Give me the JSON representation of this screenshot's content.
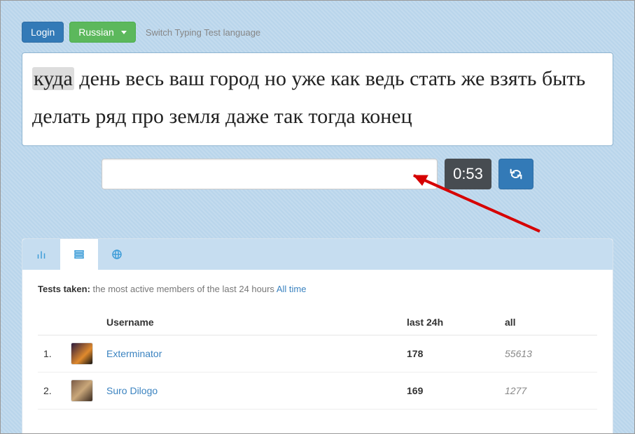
{
  "header": {
    "login_label": "Login",
    "language_label": "Russian",
    "switch_note": "Switch Typing Test language"
  },
  "words": [
    "куда",
    "день",
    "весь",
    "ваш",
    "город",
    "но",
    "уже",
    "как",
    "ведь",
    "стать",
    "же",
    "взять",
    "быть",
    "делать",
    "ряд",
    "про",
    "земля",
    "даже",
    "так",
    "тогда",
    "конец"
  ],
  "current_word_index": 0,
  "typing": {
    "input_value": "",
    "timer": "0:53"
  },
  "stats": {
    "tests_taken_label": "Tests taken:",
    "tests_taken_desc": "the most active members of the last 24 hours",
    "all_time_link": "All time",
    "columns": {
      "rank": "",
      "avatar": "",
      "username": "Username",
      "last24": "last 24h",
      "all": "all"
    },
    "rows": [
      {
        "rank": "1.",
        "username": "Exterminator",
        "last24": "178",
        "all": "55613",
        "avatar_bg": "linear-gradient(135deg,#2b1a3d,#e08a2d 60%,#111)"
      },
      {
        "rank": "2.",
        "username": "Suro Dilogo",
        "last24": "169",
        "all": "1277",
        "avatar_bg": "linear-gradient(135deg,#7a5a46,#c9a77a 50%,#3a2a1f)"
      }
    ]
  }
}
